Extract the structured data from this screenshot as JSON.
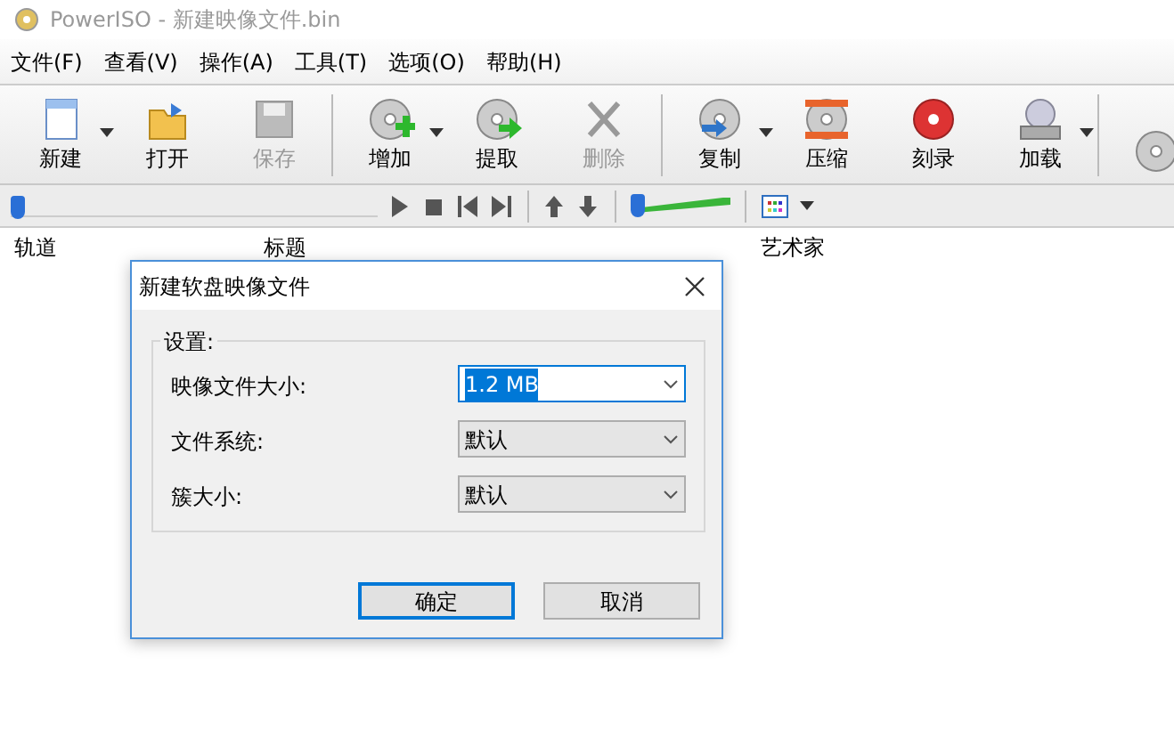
{
  "window": {
    "title": "PowerISO - 新建映像文件.bin"
  },
  "menu": [
    {
      "label": "文件(F)"
    },
    {
      "label": "查看(V)"
    },
    {
      "label": "操作(A)"
    },
    {
      "label": "工具(T)"
    },
    {
      "label": "选项(O)"
    },
    {
      "label": "帮助(H)"
    }
  ],
  "toolbar": [
    {
      "kind": "new",
      "label": "新建",
      "disabled": false,
      "dropdown": true
    },
    {
      "kind": "open",
      "label": "打开",
      "disabled": false,
      "dropdown": false
    },
    {
      "kind": "save",
      "label": "保存",
      "disabled": true,
      "dropdown": false
    },
    {
      "kind": "add",
      "label": "增加",
      "disabled": false,
      "dropdown": true
    },
    {
      "kind": "extract",
      "label": "提取",
      "disabled": false,
      "dropdown": false
    },
    {
      "kind": "delete",
      "label": "删除",
      "disabled": true,
      "dropdown": false
    },
    {
      "kind": "copy",
      "label": "复制",
      "disabled": false,
      "dropdown": true
    },
    {
      "kind": "compress",
      "label": "压缩",
      "disabled": false,
      "dropdown": false
    },
    {
      "kind": "burn",
      "label": "刻录",
      "disabled": false,
      "dropdown": false
    },
    {
      "kind": "mount",
      "label": "加载",
      "disabled": false,
      "dropdown": true
    },
    {
      "kind": "help"
    }
  ],
  "player": {
    "seek": {
      "level": 0.0
    },
    "volume": {
      "level": 0.0
    }
  },
  "list": {
    "columns": [
      {
        "label": "轨道"
      },
      {
        "label": "标题"
      },
      {
        "label": "艺术家"
      }
    ]
  },
  "dialog": {
    "title": "新建软盘映像文件",
    "group": "设置:",
    "fields": [
      {
        "label": "映像文件大小:",
        "value": "1.2 MB",
        "focused": true
      },
      {
        "label": "文件系统:",
        "value": "默认",
        "focused": false
      },
      {
        "label": "簇大小:",
        "value": "默认",
        "focused": false
      }
    ],
    "buttons": [
      {
        "label": "确定",
        "default": true
      },
      {
        "label": "取消",
        "default": false
      }
    ]
  }
}
